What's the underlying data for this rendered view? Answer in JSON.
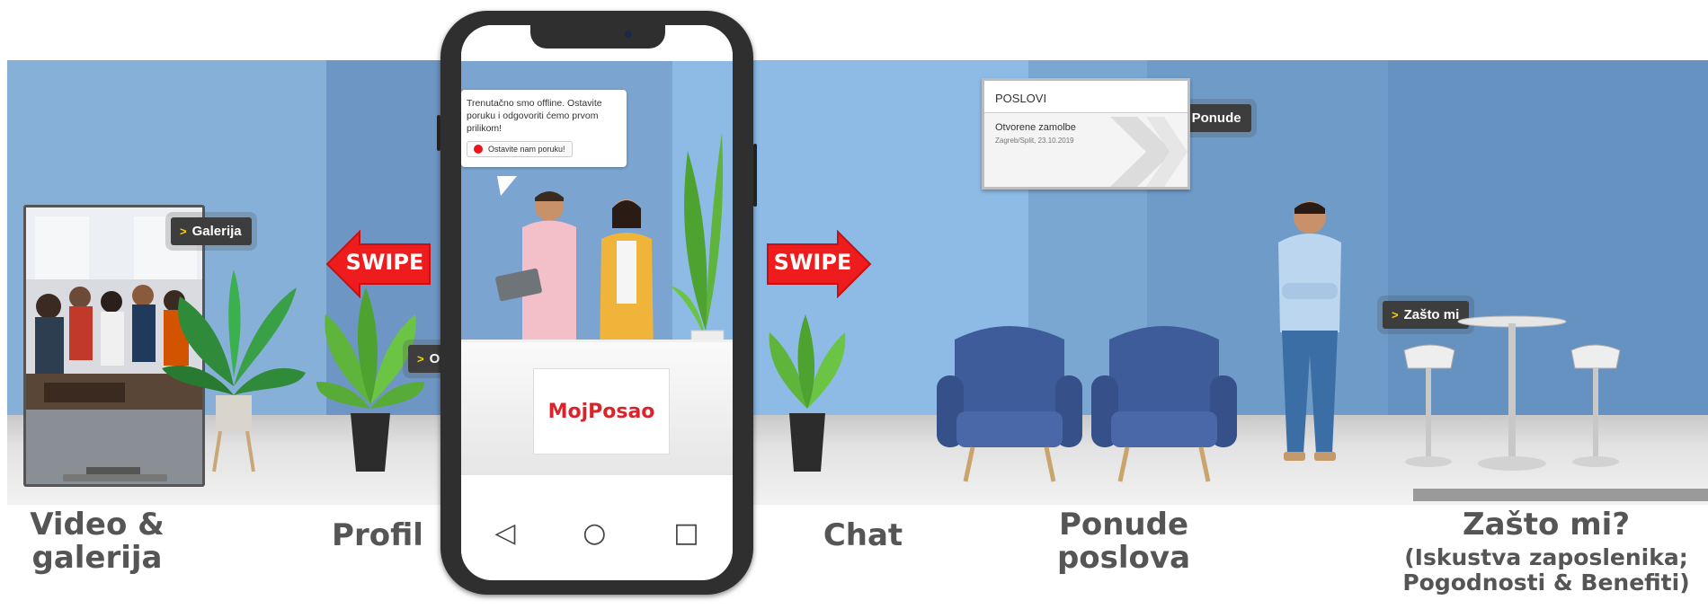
{
  "tags": {
    "galerija": "Galerija",
    "onama": "O nama",
    "ponude": "Ponude",
    "zasto": "Zašto mi"
  },
  "swipe_left": "SWIPE",
  "swipe_right": "SWIPE",
  "section_labels": {
    "video_line1": "Video &",
    "video_line2": "galerija",
    "profil": "Profil",
    "chat": "Chat",
    "ponude_line1": "Ponude",
    "ponude_line2": "poslova",
    "zasto_title": "Zašto mi?",
    "zasto_sub1": "(Iskustva zaposlenika;",
    "zasto_sub2": "Pogodnosti & Benefiti)"
  },
  "jobs_board": {
    "header": "POSLOVI",
    "item_title": "Otvorene zamolbe",
    "item_meta": "Zagreb/Split, 23.10.2019"
  },
  "chat_bubble": {
    "message": "Trenutačno smo offline. Ostavite poruku i odgovoriti ćemo prvom prilikom!",
    "button": "Ostavite nam poruku!"
  },
  "counter_brand": "MojPosao",
  "phone_nav": {
    "back": "◁",
    "home": "○",
    "recents": "□"
  },
  "colors": {
    "wall": "#7aa6d2",
    "swipe_red": "#ee1c1c",
    "brand_red": "#d8242a",
    "tag_chevron": "#ffcf00",
    "chair_blue": "#3f5c9a"
  }
}
